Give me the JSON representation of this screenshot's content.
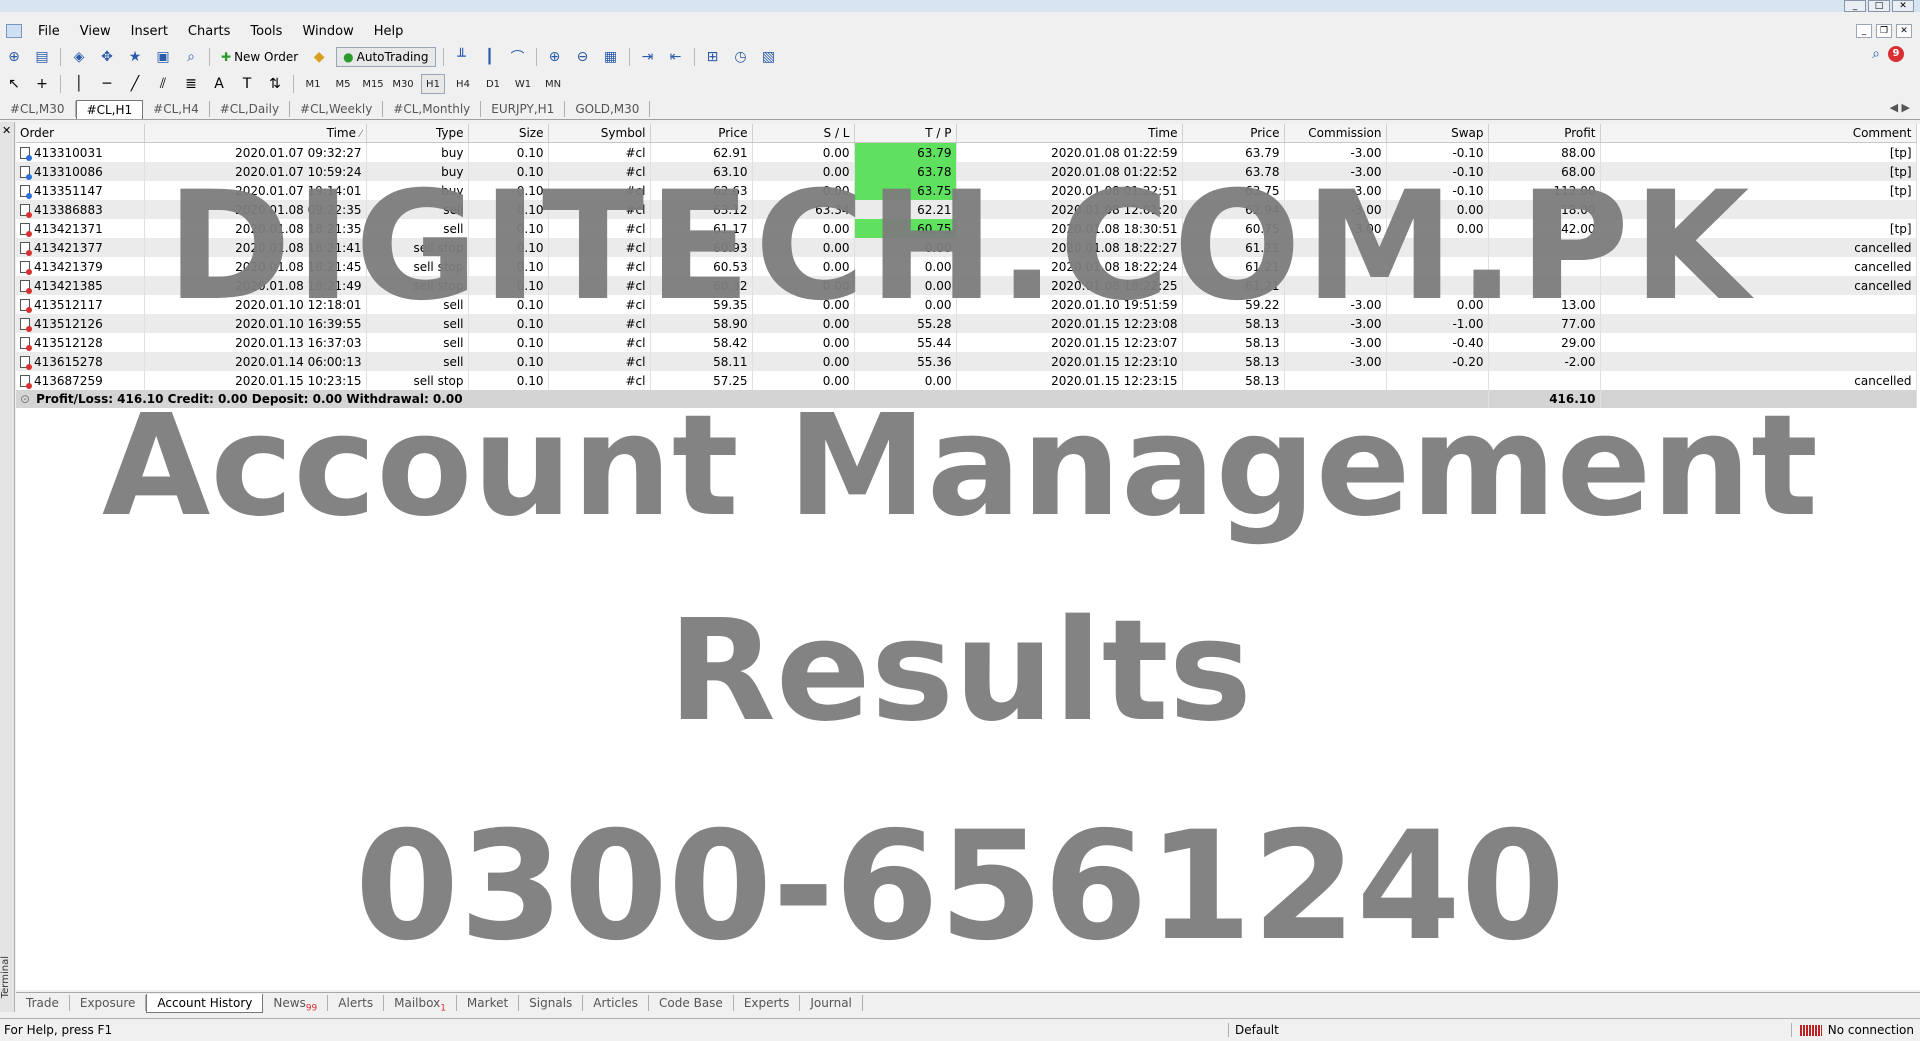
{
  "menu": [
    "File",
    "View",
    "Insert",
    "Charts",
    "Tools",
    "Window",
    "Help"
  ],
  "toolbar": {
    "new_order": "New Order",
    "autotrading": "AutoTrading",
    "notifications_count": "9"
  },
  "timeframes": [
    "M1",
    "M5",
    "M15",
    "M30",
    "H1",
    "H4",
    "D1",
    "W1",
    "MN"
  ],
  "chart_tabs": [
    "#CL,M30",
    "#CL,H1",
    "#CL,H4",
    "#CL,Daily",
    "#CL,Weekly",
    "#CL,Monthly",
    "EURJPY,H1",
    "GOLD,M30"
  ],
  "columns": [
    "Order",
    "Time",
    "Type",
    "Size",
    "Symbol",
    "Price",
    "S / L",
    "T / P",
    "Time",
    "Price",
    "Commission",
    "Swap",
    "Profit",
    "Comment"
  ],
  "rows": [
    [
      "413310031",
      "2020.01.07 09:32:27",
      "buy",
      "0.10",
      "#cl",
      "62.91",
      "0.00",
      "63.79",
      "2020.01.08 01:22:59",
      "63.79",
      "-3.00",
      "-0.10",
      "88.00",
      "[tp]"
    ],
    [
      "413310086",
      "2020.01.07 10:59:24",
      "buy",
      "0.10",
      "#cl",
      "63.10",
      "0.00",
      "63.78",
      "2020.01.08 01:22:52",
      "63.78",
      "-3.00",
      "-0.10",
      "68.00",
      "[tp]"
    ],
    [
      "413351147",
      "2020.01.07 19:14:01",
      "buy",
      "0.10",
      "#cl",
      "62.63",
      "0.00",
      "63.75",
      "2020.01.08 01:22:51",
      "63.75",
      "-3.00",
      "-0.10",
      "112.00",
      "[tp]"
    ],
    [
      "413386883",
      "2020.01.08 09:22:35",
      "sell",
      "0.10",
      "#cl",
      "63.12",
      "63.34",
      "62.21",
      "2020.01.08 12:01:20",
      "62.94",
      "-3.00",
      "0.00",
      "18.00",
      ""
    ],
    [
      "413421371",
      "2020.01.08 18:21:35",
      "sell",
      "0.10",
      "#cl",
      "61.17",
      "0.00",
      "60.75",
      "2020.01.08 18:30:51",
      "60.75",
      "-3.00",
      "0.00",
      "42.00",
      "[tp]"
    ],
    [
      "413421377",
      "2020.01.08 18:21:41",
      "sell stop",
      "0.10",
      "#cl",
      "60.93",
      "0.00",
      "0.00",
      "2020.01.08 18:22:27",
      "61.21",
      "",
      "",
      "",
      "cancelled"
    ],
    [
      "413421379",
      "2020.01.08 18:21:45",
      "sell stop",
      "0.10",
      "#cl",
      "60.53",
      "0.00",
      "0.00",
      "2020.01.08 18:22:24",
      "61.21",
      "",
      "",
      "",
      "cancelled"
    ],
    [
      "413421385",
      "2020.01.08 18:21:49",
      "sell stop",
      "0.10",
      "#cl",
      "60.32",
      "0.00",
      "0.00",
      "2020.01.08 18:22:25",
      "61.21",
      "",
      "",
      "",
      "cancelled"
    ],
    [
      "413512117",
      "2020.01.10 12:18:01",
      "sell",
      "0.10",
      "#cl",
      "59.35",
      "0.00",
      "0.00",
      "2020.01.10 19:51:59",
      "59.22",
      "-3.00",
      "0.00",
      "13.00",
      ""
    ],
    [
      "413512126",
      "2020.01.10 16:39:55",
      "sell",
      "0.10",
      "#cl",
      "58.90",
      "0.00",
      "55.28",
      "2020.01.15 12:23:08",
      "58.13",
      "-3.00",
      "-1.00",
      "77.00",
      ""
    ],
    [
      "413512128",
      "2020.01.13 16:37:03",
      "sell",
      "0.10",
      "#cl",
      "58.42",
      "0.00",
      "55.44",
      "2020.01.15 12:23:07",
      "58.13",
      "-3.00",
      "-0.40",
      "29.00",
      ""
    ],
    [
      "413615278",
      "2020.01.14 06:00:13",
      "sell",
      "0.10",
      "#cl",
      "58.11",
      "0.00",
      "55.36",
      "2020.01.15 12:23:10",
      "58.13",
      "-3.00",
      "-0.20",
      "-2.00",
      ""
    ],
    [
      "413687259",
      "2020.01.15 10:23:15",
      "sell stop",
      "0.10",
      "#cl",
      "57.25",
      "0.00",
      "0.00",
      "2020.01.15 12:23:15",
      "58.13",
      "",
      "",
      "",
      "cancelled"
    ]
  ],
  "tp_highlight_rows": [
    0,
    1,
    2,
    4
  ],
  "summary": {
    "text": "Profit/Loss: 416.10  Credit: 0.00  Deposit: 0.00  Withdrawal: 0.00",
    "total": "416.10"
  },
  "watermark": [
    "DIGITECH.COM.PK",
    "Account Management",
    "Results",
    "0300-6561240"
  ],
  "bottom_tabs": [
    "Trade",
    "Exposure",
    "Account History",
    "News",
    "Alerts",
    "Mailbox",
    "Market",
    "Signals",
    "Articles",
    "Code Base",
    "Experts",
    "Journal"
  ],
  "news_count": "99",
  "mailbox_count": "1",
  "terminal_label": "Terminal",
  "status": {
    "help": "For Help, press F1",
    "profile": "Default",
    "connection": "No connection"
  }
}
